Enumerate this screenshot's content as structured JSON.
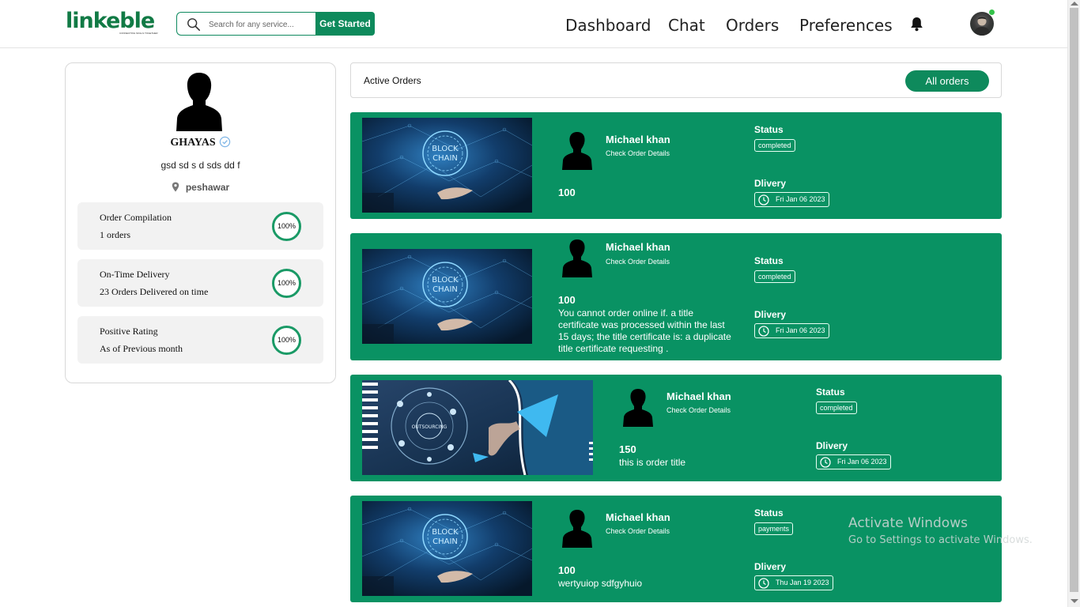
{
  "header": {
    "logo_text": "linkeble",
    "logo_tagline": "CONNECTING SKILLS TOGETHER",
    "search_placeholder": "Search for any service...",
    "get_started_label": "Get Started",
    "nav": [
      "Dashboard",
      "Chat",
      "Orders",
      "Preferences"
    ],
    "accent_color": "#0e8a5c"
  },
  "profile": {
    "name": "GHAYAS",
    "bio": "gsd sd s d sds dd f",
    "location": "peshawar",
    "stats": [
      {
        "title": "Order Compilation",
        "subtitle": "1 orders",
        "percent": "100%"
      },
      {
        "title": "On-Time Delivery",
        "subtitle": "23 Orders Delivered on time",
        "percent": "100%"
      },
      {
        "title": "Positive Rating",
        "subtitle": "As of Previous month",
        "percent": "100%"
      }
    ]
  },
  "orders_panel": {
    "title": "Active Orders",
    "all_orders_label": "All orders"
  },
  "orders": [
    {
      "name": "Michael khan",
      "sub": "Check Order Details",
      "price": "100",
      "desc": "",
      "status_label": "Status",
      "status": "completed",
      "delivery_label": "Dlivery",
      "date": "Fri Jan 06 2023",
      "thumb_text_1": "BLOCK",
      "thumb_text_2": "CHAIN"
    },
    {
      "name": "Michael khan",
      "sub": "Check Order Details",
      "price": "100",
      "desc": "You cannot order online if. a title certificate was processed within the last 15 days; the title certificate is: a duplicate title certificate requesting .",
      "status_label": "Status",
      "status": "completed",
      "delivery_label": "Dlivery",
      "date": "Fri Jan 06 2023",
      "thumb_text_1": "BLOCK",
      "thumb_text_2": "CHAIN"
    },
    {
      "name": "Michael khan",
      "sub": "Check Order Details",
      "price": "150",
      "desc": "this is order title",
      "status_label": "Status",
      "status": "completed",
      "delivery_label": "Dlivery",
      "date": "Fri Jan 06 2023",
      "thumb_text_1": "OUTSOURCING",
      "thumb_text_2": ""
    },
    {
      "name": "Michael khan",
      "sub": "Check Order Details",
      "price": "100",
      "desc": "wertyuiop sdfgyhuio",
      "status_label": "Status",
      "status": "payments",
      "delivery_label": "Dlivery",
      "date": "Thu Jan 19 2023",
      "thumb_text_1": "BLOCK",
      "thumb_text_2": "CHAIN"
    }
  ],
  "watermark": {
    "title": "Activate Windows",
    "subtitle": "Go to Settings to activate Windows."
  }
}
